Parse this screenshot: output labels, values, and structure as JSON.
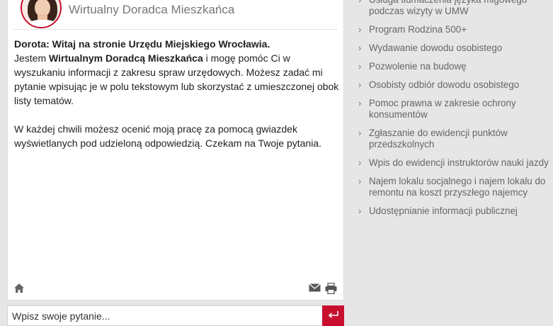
{
  "chat": {
    "title": "Wirtualny Doradca Mieszkańca",
    "greeting_bold": "Dorota: Witaj na stronie Urzędu Miejskiego Wrocławia.",
    "intro_before": "Jestem ",
    "intro_bold": "Wirtualnym Doradcą Mieszkańca",
    "intro_after": " i mogę pomóc Ci w wyszukaniu informacji z zakresu spraw urzędowych. Możesz zadać mi pytanie wpisując je w polu tekstowym lub skorzystać z umieszczonej obok listy tematów.",
    "paragraph2": "W każdej chwili możesz ocenić moją pracę za pomocą gwiazdek wyświetlanych pod udzieloną odpowiedzią. Czekam na Twoje pytania.",
    "icons": [
      "home-icon",
      "mail-icon",
      "print-icon"
    ]
  },
  "input": {
    "placeholder": "Wpisz swoje pytanie...",
    "send_icon": "return-arrow-icon"
  },
  "topics": [
    "Usługa tłumaczenia języka migowego podczas wizyty w UMW",
    "Program Rodzina 500+",
    "Wydawanie dowodu osobistego",
    "Pozwolenie na budowę",
    "Osobisty odbiór dowodu osobistego",
    "Pomoc prawna w zakresie ochrony konsumentów",
    "Zgłaszanie do ewidencji punktów przedszkolnych",
    "Wpis do ewidencji instruktorów nauki jazdy",
    "Najem lokalu socjalnego i najem lokalu do remontu na koszt przyszłego najemcy",
    "Udostępnianie informacji publicznej"
  ],
  "colors": {
    "accent": "#c8102e",
    "background": "#e6e6e6",
    "link": "#666666"
  }
}
